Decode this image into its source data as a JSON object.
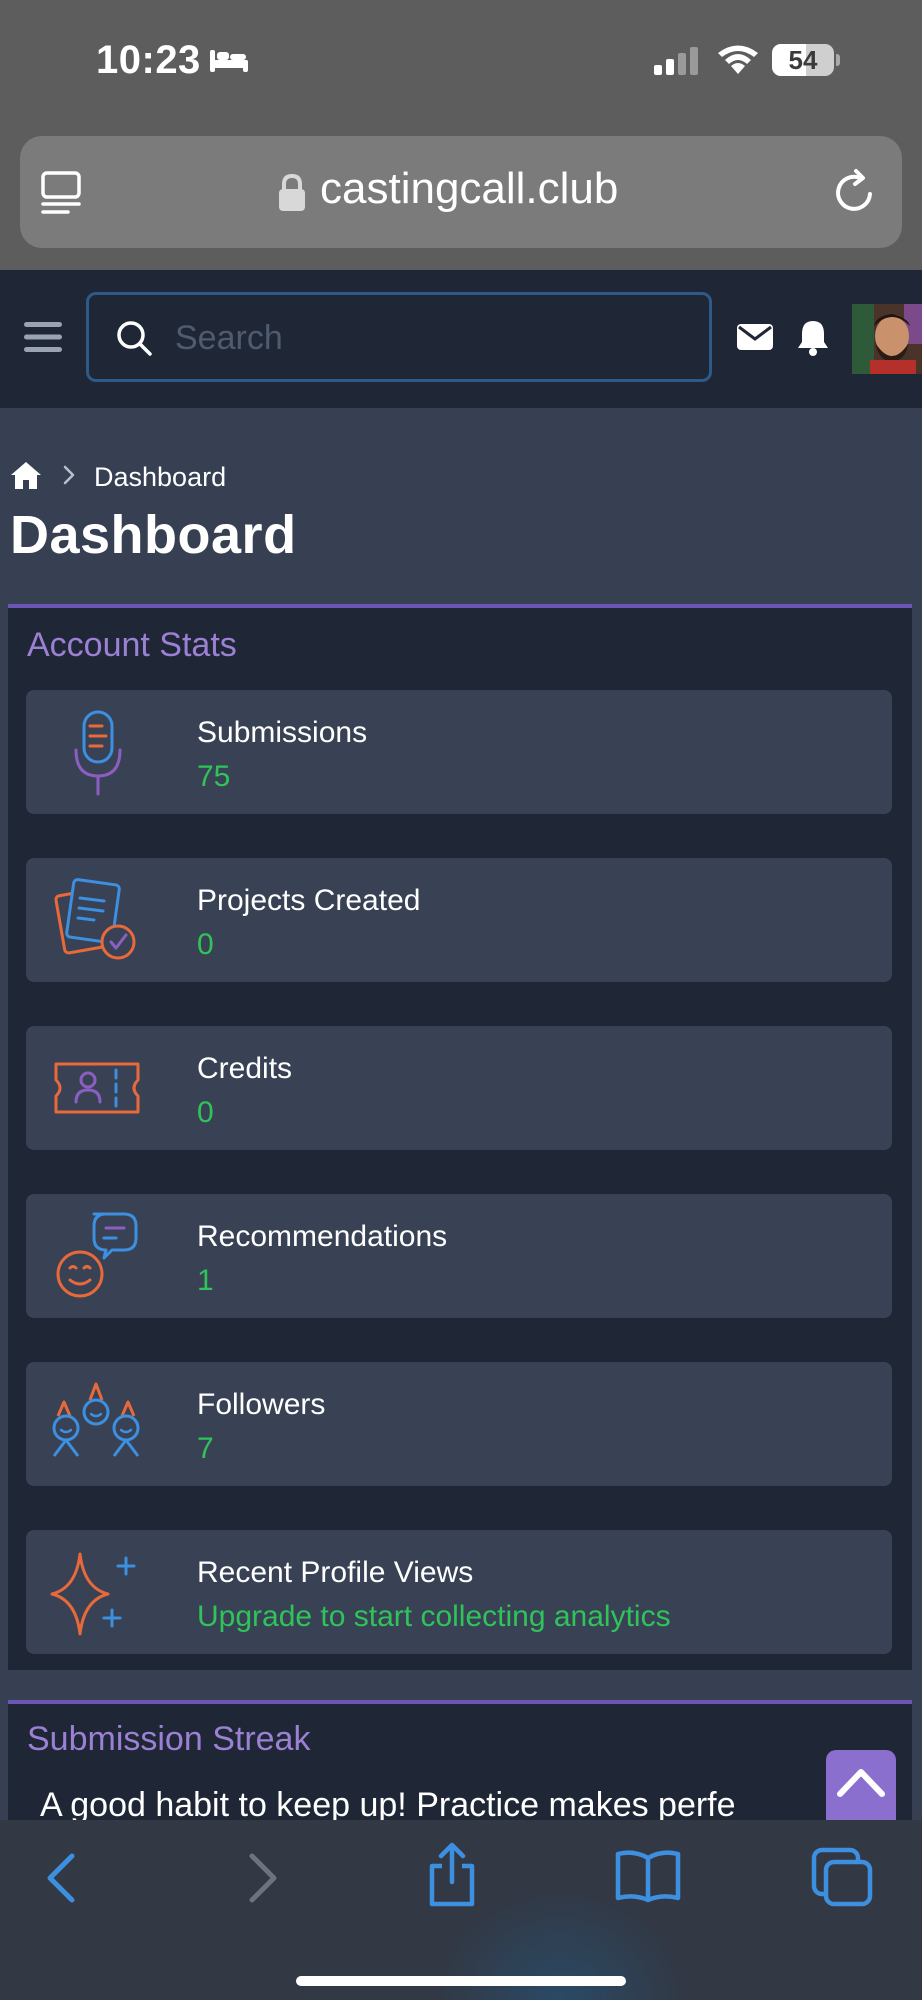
{
  "status_bar": {
    "time": "10:23",
    "battery": "54"
  },
  "browser": {
    "url": "castingcall.club"
  },
  "header": {
    "search_placeholder": "Search"
  },
  "breadcrumb": {
    "current": "Dashboard"
  },
  "page": {
    "title": "Dashboard"
  },
  "account_stats": {
    "title": "Account Stats",
    "items": [
      {
        "label": "Submissions",
        "value": "75",
        "icon": "microphone-icon"
      },
      {
        "label": "Projects Created",
        "value": "0",
        "icon": "project-clipboard-icon"
      },
      {
        "label": "Credits",
        "value": "0",
        "icon": "ticket-person-icon"
      },
      {
        "label": "Recommendations",
        "value": "1",
        "icon": "chat-face-icon"
      },
      {
        "label": "Followers",
        "value": "7",
        "icon": "party-people-icon"
      },
      {
        "label": "Recent Profile Views",
        "value": "Upgrade to start collecting analytics",
        "icon": "sparkle-icon"
      }
    ]
  },
  "submission_streak": {
    "title": "Submission Streak",
    "text": "A good habit to keep up! Practice makes perfe"
  },
  "colors": {
    "accent_purple": "#9b80d4",
    "value_green": "#2fc35a",
    "panel_bg": "#1f2736",
    "card_bg": "#394255",
    "page_bg": "#374052",
    "safari_blue": "#3d8fe0"
  }
}
